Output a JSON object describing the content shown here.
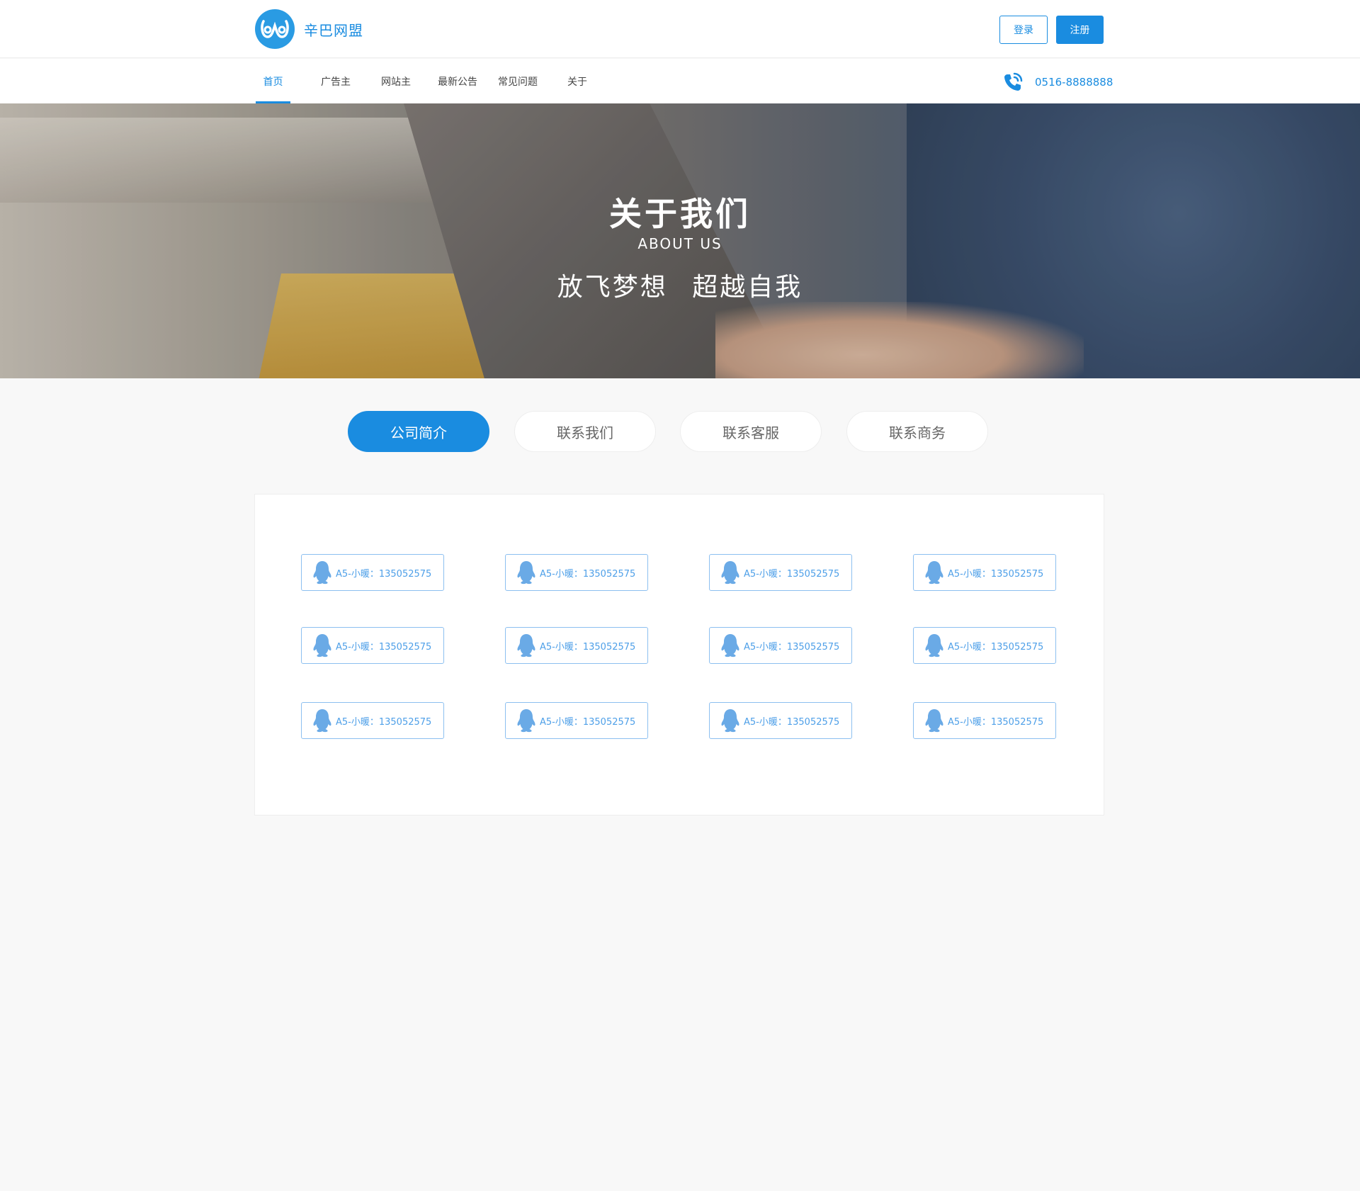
{
  "header": {
    "logo_text": "辛巴网盟",
    "login_label": "登录",
    "register_label": "注册",
    "brand_color": "#1a8ce0"
  },
  "nav": {
    "items": [
      {
        "label": "首页",
        "active": true
      },
      {
        "label": "广告主",
        "active": false
      },
      {
        "label": "网站主",
        "active": false
      },
      {
        "label": "最新公告",
        "active": false
      },
      {
        "label": "常见问题",
        "active": false
      },
      {
        "label": "关于",
        "active": false
      }
    ],
    "phone_icon": "phone-icon",
    "phone": "0516-8888888"
  },
  "banner": {
    "title": "关于我们",
    "subtitle": "ABOUT US",
    "slogan": "放飞梦想 超越自我"
  },
  "tabs": [
    {
      "label": "公司简介",
      "active": true
    },
    {
      "label": "联系我们",
      "active": false
    },
    {
      "label": "联系客服",
      "active": false
    },
    {
      "label": "联系商务",
      "active": false
    }
  ],
  "contacts": {
    "icon": "qq-penguin-icon",
    "items": [
      "A5-小暖：135052575",
      "A5-小暖：135052575",
      "A5-小暖：135052575",
      "A5-小暖：135052575",
      "A5-小暖：135052575",
      "A5-小暖：135052575",
      "A5-小暖：135052575",
      "A5-小暖：135052575",
      "A5-小暖：135052575",
      "A5-小暖：135052575",
      "A5-小暖：135052575",
      "A5-小暖：135052575"
    ]
  }
}
